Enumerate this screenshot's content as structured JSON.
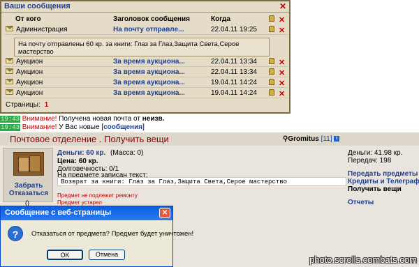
{
  "messages": {
    "title": "Ваши сообщения",
    "columns": [
      "От кого",
      "Заголовок сообщения",
      "Когда"
    ],
    "rows": [
      {
        "from": "Администрация",
        "subject": "На почту отправле...",
        "date": "22.04.11 19:25"
      },
      {
        "from": "Аукцион",
        "subject": "За время аукциона...",
        "date": "22.04.11 13:34"
      },
      {
        "from": "Аукцион",
        "subject": "За время аукциона...",
        "date": "22.04.11 13:34"
      },
      {
        "from": "Аукцион",
        "subject": "За время аукциона...",
        "date": "19.04.11 14:24"
      },
      {
        "from": "Аукцион",
        "subject": "За время аукциона...",
        "date": "19.04.11 14:24"
      }
    ],
    "expanded_body": "На почту отправлены 60 кр. за книги: Глаз за Глаз,Защита Света,Серое мастерство",
    "pages_label": "Страницы:",
    "pages_value": "1"
  },
  "chat": [
    {
      "time": "19:43",
      "warn": "Внимание!",
      "text": " Получена новая почта от ",
      "bold": "неизв."
    },
    {
      "time": "19:43",
      "warn": "Внимание!",
      "text": " У Вас новые [",
      "link": "сообщения",
      "tail": "]"
    }
  ],
  "post": {
    "title": "Почтовое отделение .   Получить вещи",
    "user": "Gromitus",
    "level": "[11]",
    "item": {
      "take_label": "Забрать",
      "refuse_label": "Отказаться",
      "paren": "()",
      "money": "Деньги: 60 кр.",
      "mass": "(Масса: 0)",
      "price": "Цена: 60 кр.",
      "durability": "Долговечность: 0/1",
      "inscription_label": "На предмете записан текст:",
      "inscription": "Возврат за книги: Глаз за Глаз,Защита Света,Серое мастерство",
      "warn1": "Предмет не подлежит ремонту",
      "warn2": "Предмет устарел"
    },
    "side": {
      "money": "Деньги: 41.98 кр.",
      "transfers": "Передач: 198",
      "link1": "Передать предметы",
      "link2": "Кредиты и Телеграф",
      "link3": "Получить вещи",
      "link4": "Отчеты"
    }
  },
  "dialog": {
    "title": "Сообщение с веб-страницы",
    "message": "Отказаться от предмета? Предмет будет уничтожен!",
    "ok": "OK",
    "cancel": "Отмена"
  },
  "watermark": "photo.scrolls.combats.com",
  "colors": {
    "accent": "#1f3f8f",
    "warning": "#c00000",
    "panel": "#e4dcc6",
    "dialog_title": "#0a5fe0"
  }
}
